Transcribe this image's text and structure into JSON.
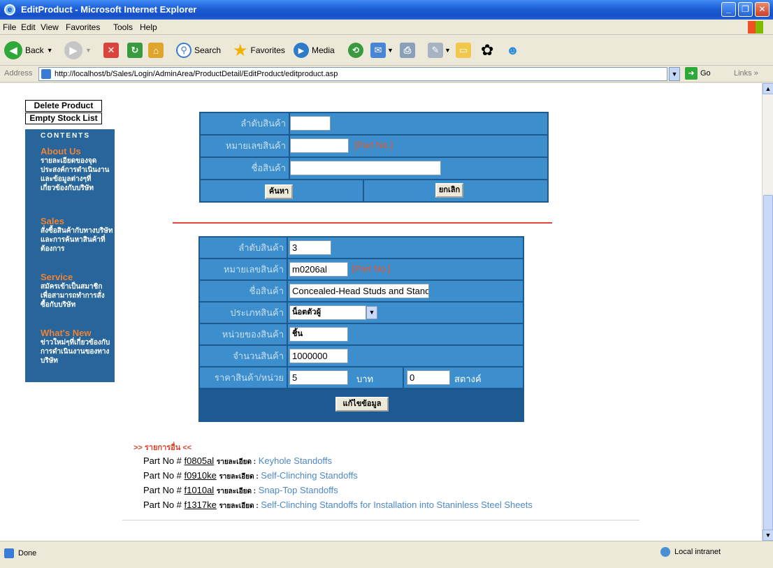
{
  "window": {
    "title": "EditProduct - Microsoft Internet Explorer",
    "minimize": "_",
    "restore": "❐",
    "close": "✕"
  },
  "menu": [
    "File",
    "Edit",
    "View",
    "Favorites",
    "Tools",
    "Help"
  ],
  "toolbar": {
    "back": "Back",
    "search": "Search",
    "favorites": "Favorites",
    "media": "Media"
  },
  "address": {
    "label": "Address",
    "url": "http://localhost/b/Sales/Login/AdminArea/ProductDetail/EditProduct/editproduct.asp",
    "go": "Go",
    "links": "Links"
  },
  "left_nav": {
    "buttons": [
      "Delete Product",
      "Empty Stock List"
    ],
    "contents_title": "CONTENTS",
    "sections": [
      {
        "title": "About Us",
        "desc": "รายละเอียดของจุดประสงค์การดำเนินงานและข้อมูลต่างๆที่เกี่ยวข้องกับบริษัท"
      },
      {
        "title": "Sales",
        "desc": "สั่งซื้อสินค้ากับทางบริษัทและการค้นหาสินค้าที่ต้องการ"
      },
      {
        "title": "Service",
        "desc": "สมัครเข้าเป็นสมาชิกเพื่อสามารถทำการสั่งซื้อกับบริษัท"
      },
      {
        "title": "What's New",
        "title_a": "What's New",
        "title_b": "s",
        "desc": "ข่าวใหม่ๆที่เกี่ยวข้องกับการดำเนินงานของทางบริษัท"
      }
    ]
  },
  "search_form": {
    "label_order": "ลำดับสินค้า",
    "label_partno": "หมายเลขสินค้า",
    "label_name": "ชื่อสินค้า",
    "order_value": "",
    "partno_value": "",
    "name_value": "",
    "partno_hint": "[Part No.]",
    "search_button": "ค้นหา",
    "cancel_button": "ยกเลิก"
  },
  "edit_form": {
    "label_order": "ลำดับสินค้า",
    "label_partno": "หมายเลขสินค้า",
    "label_name": "ชื่อสินค้า",
    "label_type": "ประเภทสินค้า",
    "label_unit": "หน่วยของสินค้า",
    "label_qty": "จำนวนสินค้า",
    "label_price": "ราคาสินค้า/หน่วย",
    "order_value": "3",
    "partno_value": "m0206al",
    "partno_hint": "[Part No.]",
    "name_value": "Concealed-Head Studs and Standoffs",
    "type_value": "น็อตตัวผู้",
    "unit_value": "ชิ้น",
    "qty_value": "1000000",
    "price_baht": "5",
    "baht_label": "บาท",
    "price_satang": "0",
    "satang_label": "สตางค์",
    "save_button": "แก้ไขข้อมูล"
  },
  "other_items": {
    "title": ">> รายการอื่น <<",
    "prefix": "Part No #",
    "detail_label": "รายละเอียด :",
    "items": [
      {
        "part": "f0805al",
        "name": "Keyhole Standoffs"
      },
      {
        "part": "f0910ke",
        "name": "Self-Clinching Standoffs"
      },
      {
        "part": "f1010al",
        "name": "Snap-Top Standoffs"
      },
      {
        "part": "f1317ke",
        "name": "Self-Clinching Standoffs for Installation into Staninless Steel Sheets"
      }
    ]
  },
  "status": {
    "left": "Done",
    "zone": "Local intranet"
  },
  "colors": {
    "form_dark": "#1e5a92",
    "form_cell": "#3c8fcc",
    "nav_bg": "#27659a",
    "nav_title": "#f08236",
    "accent_red": "#e0443a"
  }
}
